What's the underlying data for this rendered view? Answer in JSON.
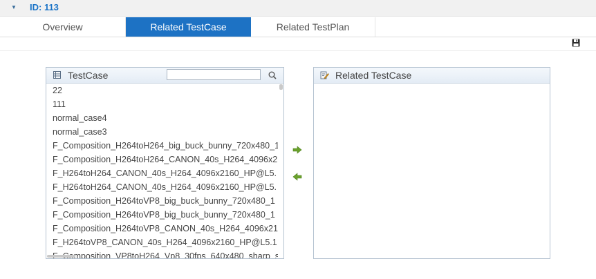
{
  "header": {
    "title": "ID: 113",
    "toggle_icon": "triangle-down-icon"
  },
  "tabs": [
    {
      "label": "Overview",
      "active": false
    },
    {
      "label": "Related TestCase",
      "active": true
    },
    {
      "label": "Related TestPlan",
      "active": false
    }
  ],
  "toolbar": {
    "save_icon": "floppy-disk-icon"
  },
  "left_panel": {
    "title": "TestCase",
    "icon": "list-table-icon",
    "search": {
      "value": "",
      "placeholder": "",
      "icon": "search-icon"
    },
    "items": [
      "22",
      "111",
      "normal_case4",
      "normal_case3",
      "F_Composition_H264toH264_big_buck_bunny_720x480_1",
      "F_Composition_H264toH264_CANON_40s_H264_4096x2",
      "F_H264toH264_CANON_40s_H264_4096x2160_HP@L5.",
      "F_H264toH264_CANON_40s_H264_4096x2160_HP@L5.",
      "F_Composition_H264toVP8_big_buck_bunny_720x480_1",
      "F_Composition_H264toVP8_big_buck_bunny_720x480_1",
      "F_Composition_H264toVP8_CANON_40s_H264_4096x21",
      "F_H264toVP8_CANON_40s_H264_4096x2160_HP@L5.1",
      "F_Composition_VP8toH264_Vp8_30fps_640x480_sharp_s"
    ]
  },
  "transfer": {
    "add_icon": "arrow-right-icon",
    "remove_icon": "arrow-left-icon",
    "color": "#6aa22c"
  },
  "right_panel": {
    "title": "Related TestCase",
    "icon": "edit-pencil-icon",
    "items": []
  },
  "colors": {
    "accent": "#1d72c4",
    "panel_border": "#b4c2d0",
    "header_title": "#1a73c7"
  }
}
